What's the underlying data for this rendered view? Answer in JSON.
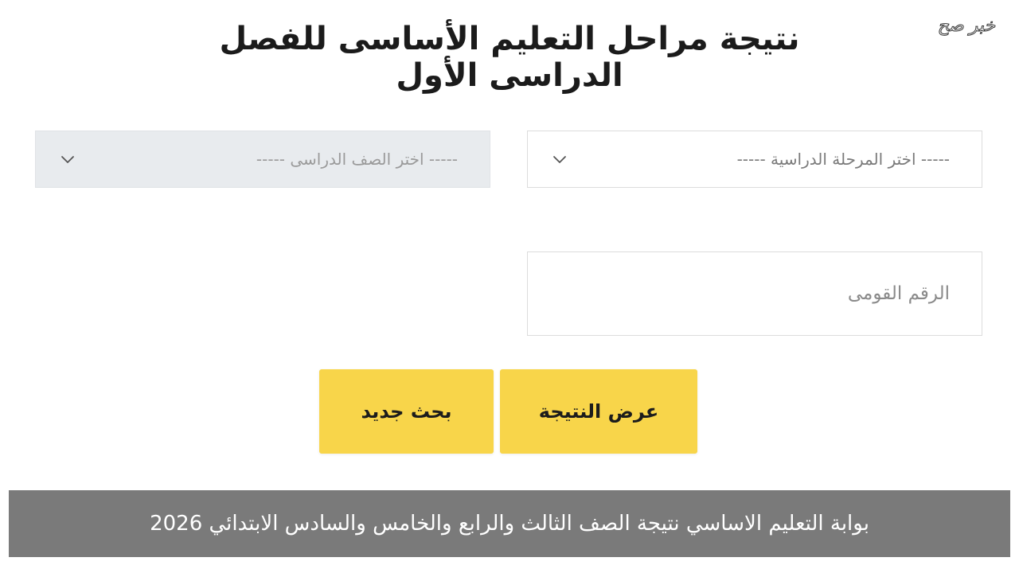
{
  "watermark": "خبر صح",
  "header": {
    "title": "نتيجة مراحل التعليم الأساسى للفصل الدراسى الأول"
  },
  "form": {
    "stage_select": {
      "selected": "----- اختر المرحلة الدراسية -----",
      "icon": "chevron-down-icon"
    },
    "grade_select": {
      "selected": "----- اختر الصف الدراسى -----",
      "icon": "chevron-down-icon",
      "disabled": true
    },
    "national_id": {
      "placeholder": "الرقم القومى",
      "value": ""
    },
    "buttons": {
      "show_result_label": "عرض النتيجة",
      "new_search_label": "بحث جديد"
    }
  },
  "caption": {
    "text": "بوابة التعليم الاساسي نتيجة الصف الثالث والرابع والخامس والسادس الابتدائي 2026"
  },
  "colors": {
    "button_yellow": "#f8d54a",
    "caption_bg": "#7a7a7a",
    "disabled_select_bg": "#e8ebee"
  }
}
